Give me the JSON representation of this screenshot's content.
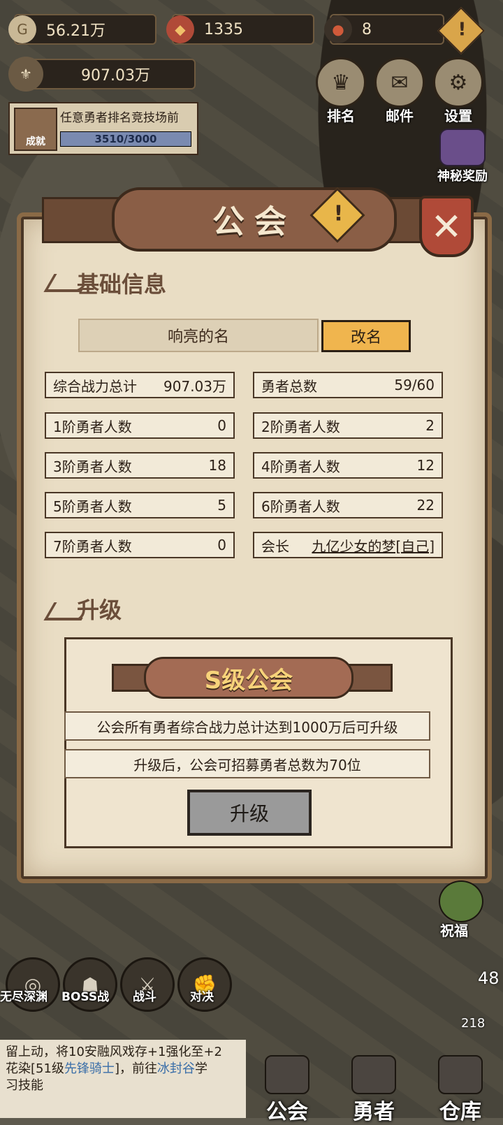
{
  "top": {
    "gold": "56.21万",
    "gems": "1335",
    "tickets": "8",
    "power": "907.03万",
    "warn": "!"
  },
  "top_buttons": [
    {
      "label": "排名",
      "icon": "trophy-icon"
    },
    {
      "label": "邮件",
      "icon": "mail-icon"
    },
    {
      "label": "设置",
      "icon": "gear-icon"
    }
  ],
  "mystery": {
    "label": "神秘奖励"
  },
  "achievement": {
    "badge": "成就",
    "text": "任意勇者排名竞技场前",
    "progress": "3510/3000",
    "fraction": 1.0
  },
  "panel": {
    "title": "公会",
    "warn": "!",
    "close": "✕",
    "basic_title": "基础信息",
    "name": "响亮的名",
    "rename": "改名",
    "stats": [
      {
        "k": "综合战力总计",
        "v": "907.03万"
      },
      {
        "k": "勇者总数",
        "v": "59/60"
      },
      {
        "k": "1阶勇者人数",
        "v": "0"
      },
      {
        "k": "2阶勇者人数",
        "v": "2"
      },
      {
        "k": "3阶勇者人数",
        "v": "18"
      },
      {
        "k": "4阶勇者人数",
        "v": "12"
      },
      {
        "k": "5阶勇者人数",
        "v": "5"
      },
      {
        "k": "6阶勇者人数",
        "v": "22"
      },
      {
        "k": "7阶勇者人数",
        "v": "0"
      },
      {
        "k": "会长",
        "v": "九亿少女的梦[自己]"
      }
    ],
    "upgrade_title": "升级",
    "grade": "S级公会",
    "info1": "公会所有勇者综合战力总计达到1000万后可升级",
    "info2": "升级后，公会可招募勇者总数为70位",
    "upgrade_button": "升级"
  },
  "bottom_left": [
    {
      "label": "无尽深渊"
    },
    {
      "label": "BOSS战"
    },
    {
      "label": "战斗"
    },
    {
      "label": "对决"
    }
  ],
  "bless": "祝福",
  "side_num": "48",
  "chat": {
    "line1": "留上动，将10安融风戏存+1强化至+2",
    "line2a": "花染[51级",
    "line2b": "先锋骑士",
    "line2c": "]，前往",
    "line2d": "冰封谷",
    "line2e": "学",
    "line3": "习技能"
  },
  "nav": [
    {
      "label": "公会"
    },
    {
      "label": "勇者"
    },
    {
      "label": "仓库"
    }
  ],
  "nav_badge": "218"
}
